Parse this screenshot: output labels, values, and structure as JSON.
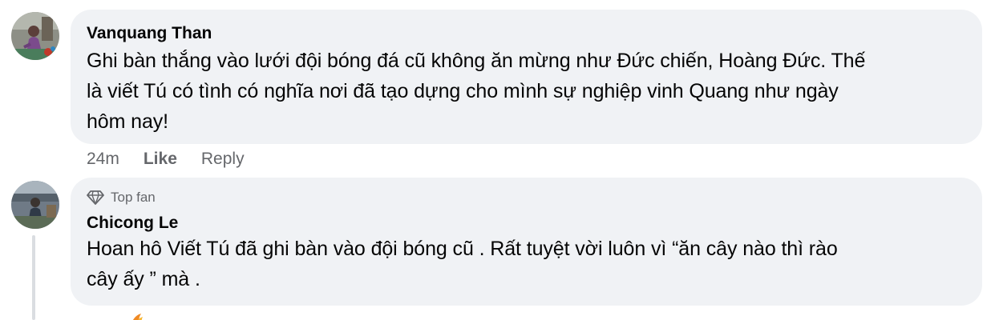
{
  "comments": [
    {
      "author": "Vanquang Than",
      "text": "Ghi bàn thắng vào lưới đội bóng đá cũ không ăn mừng như Đức chiến, Hoàng Đức. Thế là viết Tú có tình có nghĩa nơi đã tạo dựng cho mình sự nghiệp vinh Quang như ngày hôm nay!",
      "lines": [
        "Ghi bàn thắng vào lưới đội bóng đá cũ không ăn mừng như Đức chiến, Hoàng Đức. Thế",
        "là viết Tú có tình có nghĩa nơi đã tạo dựng cho mình sự nghiệp vinh Quang như ngày",
        "hôm nay!"
      ],
      "time": "24m",
      "like_label": "Like",
      "reply_label": "Reply"
    },
    {
      "badge": "Top fan",
      "badge_icon": "diamond-icon",
      "author": "Chicong Le",
      "text": "Hoan hô Viết Tú đã ghi bàn vào đội bóng cũ . Rất tuyệt vời luôn vì “ăn cây nào thì rào cây ấy ” mà .",
      "lines": [
        "Hoan hô Viết Tú đã ghi bàn vào đội bóng cũ . Rất tuyệt vời luôn vì “ăn cây nào thì rào",
        "cây ấy ” mà ."
      ]
    }
  ],
  "colors": {
    "bubble": "#f0f2f5",
    "text": "#050505",
    "secondary": "#65676b",
    "thread_line": "#dadde1"
  }
}
